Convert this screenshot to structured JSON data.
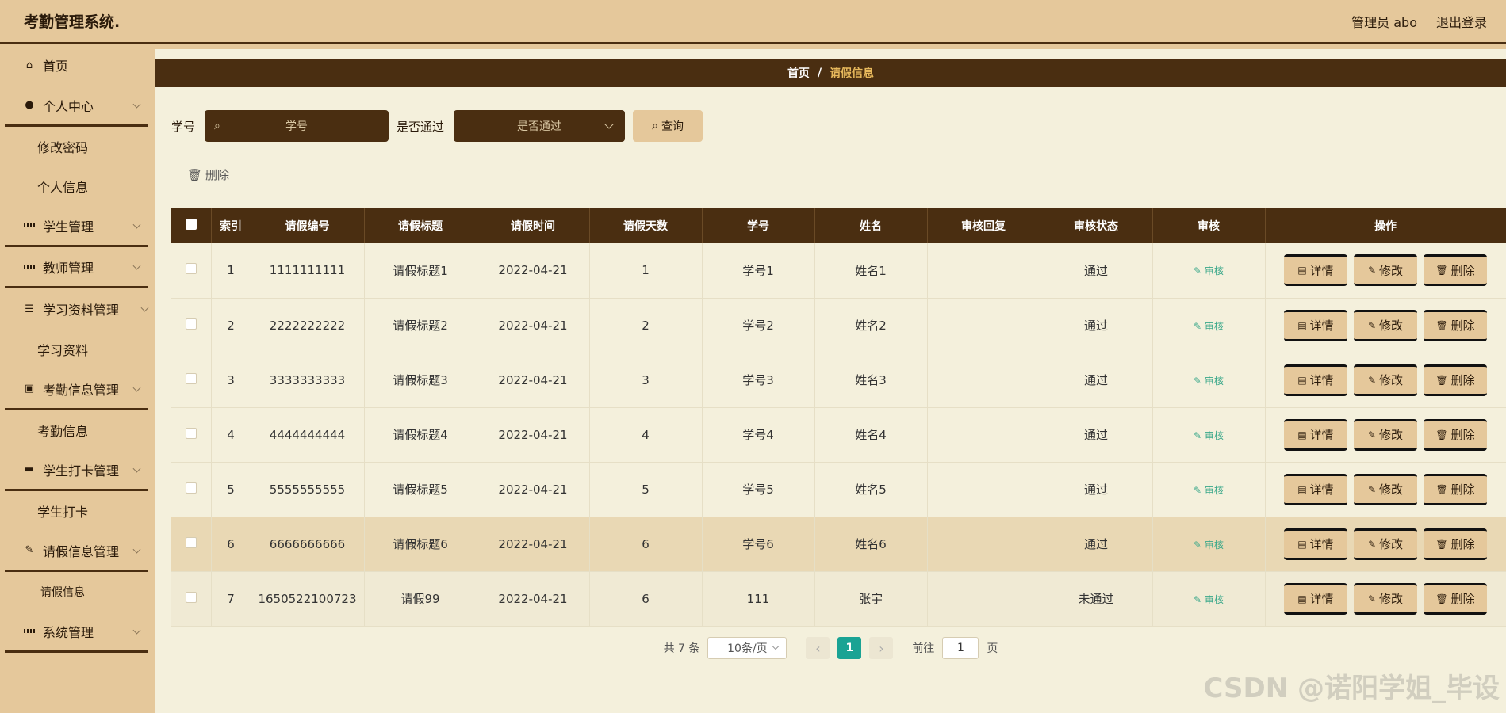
{
  "app": {
    "title": "考勤管理系统.",
    "user": "管理员 abo",
    "logout": "退出登录"
  },
  "sidebar": {
    "home": "首页",
    "personal": "个人中心",
    "personal_sub": [
      "修改密码",
      "个人信息"
    ],
    "student_mgmt": "学生管理",
    "teacher_mgmt": "教师管理",
    "material_mgmt": "学习资料管理",
    "material_sub": "学习资料",
    "attendance_mgmt": "考勤信息管理",
    "attendance_sub": "考勤信息",
    "checkin_mgmt": "学生打卡管理",
    "checkin_sub": "学生打卡",
    "leave_mgmt": "请假信息管理",
    "leave_sub": "请假信息",
    "system_mgmt": "系统管理"
  },
  "breadcrumb": {
    "home": "首页",
    "sep": "/",
    "current": "请假信息"
  },
  "filter": {
    "student_label": "学号",
    "student_placeholder": "学号",
    "pass_label": "是否通过",
    "pass_placeholder": "是否通过",
    "query": "查询"
  },
  "delete_label": "删除",
  "table": {
    "headers": [
      "索引",
      "请假编号",
      "请假标题",
      "请假时间",
      "请假天数",
      "学号",
      "姓名",
      "审核回复",
      "审核状态",
      "审核",
      "操作"
    ],
    "audit_label": "审核",
    "btn_detail": "详情",
    "btn_edit": "修改",
    "btn_delete": "删除",
    "rows": [
      {
        "index": "1",
        "code": "1111111111",
        "title": "请假标题1",
        "date": "2022-04-21",
        "days": "1",
        "sid": "学号1",
        "name": "姓名1",
        "reply": "",
        "status": "通过"
      },
      {
        "index": "2",
        "code": "2222222222",
        "title": "请假标题2",
        "date": "2022-04-21",
        "days": "2",
        "sid": "学号2",
        "name": "姓名2",
        "reply": "",
        "status": "通过"
      },
      {
        "index": "3",
        "code": "3333333333",
        "title": "请假标题3",
        "date": "2022-04-21",
        "days": "3",
        "sid": "学号3",
        "name": "姓名3",
        "reply": "",
        "status": "通过"
      },
      {
        "index": "4",
        "code": "4444444444",
        "title": "请假标题4",
        "date": "2022-04-21",
        "days": "4",
        "sid": "学号4",
        "name": "姓名4",
        "reply": "",
        "status": "通过"
      },
      {
        "index": "5",
        "code": "5555555555",
        "title": "请假标题5",
        "date": "2022-04-21",
        "days": "5",
        "sid": "学号5",
        "name": "姓名5",
        "reply": "",
        "status": "通过"
      },
      {
        "index": "6",
        "code": "6666666666",
        "title": "请假标题6",
        "date": "2022-04-21",
        "days": "6",
        "sid": "学号6",
        "name": "姓名6",
        "reply": "",
        "status": "通过"
      },
      {
        "index": "7",
        "code": "1650522100723",
        "title": "请假99",
        "date": "2022-04-21",
        "days": "6",
        "sid": "111",
        "name": "张宇",
        "reply": "",
        "status": "未通过"
      }
    ]
  },
  "pager": {
    "total": "共 7 条",
    "size": "10条/页",
    "current": "1",
    "goto": "前往",
    "goto_value": "1",
    "page_unit": "页"
  },
  "watermark": "CSDN @诺阳学姐_毕设"
}
